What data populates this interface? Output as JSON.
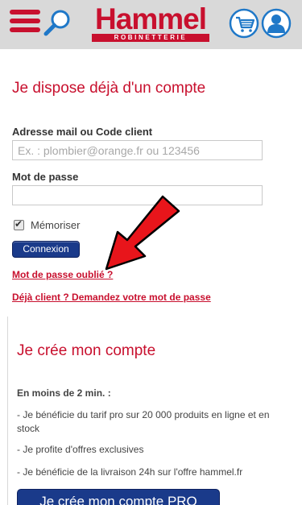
{
  "header": {
    "logo_main": "Hammel",
    "logo_sub": "ROBINETTERIE"
  },
  "login": {
    "title": "Je dispose déjà d'un compte",
    "email_label": "Adresse mail ou Code client",
    "email_placeholder": "Ex. : plombier@orange.fr ou 123456",
    "password_label": "Mot de passe",
    "remember_label": "Mémoriser",
    "remember_checked": true,
    "submit_label": "Connexion",
    "forgot_link": "Mot de passe oublié ?",
    "already_client_link": "Déjà client ? Demandez votre mot de passe"
  },
  "create": {
    "title": "Je crée mon compte",
    "intro": "En moins de 2 min. :",
    "benefits": [
      "- Je bénéficie du tarif pro sur 20 000 produits en ligne et en stock",
      "- Je profite d'offres exclusives",
      "- Je bénéficie de la livraison 24h sur l'offre hammel.fr"
    ],
    "button_label": "Je crée mon compte PRO"
  },
  "colors": {
    "brand_red": "#c8102e",
    "button_blue": "#1a3a8a",
    "header_bg": "#d9d9d9",
    "arrow_red": "#e8151b"
  },
  "icons": [
    "menu-icon",
    "search-icon",
    "cart-icon",
    "user-icon",
    "checkmark-icon",
    "red-arrow-icon"
  ]
}
